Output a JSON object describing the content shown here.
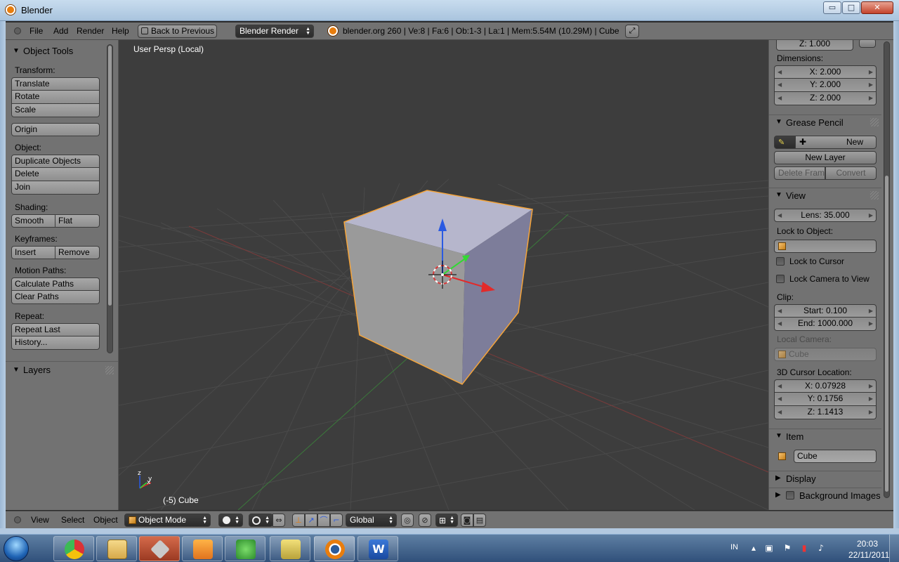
{
  "window": {
    "title": "Blender",
    "min_glyph": "▭",
    "max_glyph": "□",
    "close_glyph": "✕"
  },
  "info_header": {
    "menus": [
      "File",
      "Add",
      "Render",
      "Help"
    ],
    "back_button": "Back to Previous",
    "render_engine": "Blender Render",
    "stats": "blender.org 260 | Ve:8 | Fa:6 | Ob:1-3 | La:1 | Mem:5.54M (10.29M) | Cube"
  },
  "tool_shelf": {
    "title": "Object Tools",
    "transform_label": "Transform:",
    "translate": "Translate",
    "rotate": "Rotate",
    "scale": "Scale",
    "origin": "Origin",
    "object_label": "Object:",
    "duplicate": "Duplicate Objects",
    "delete": "Delete",
    "join": "Join",
    "shading_label": "Shading:",
    "smooth": "Smooth",
    "flat": "Flat",
    "keyframes_label": "Keyframes:",
    "insert": "Insert",
    "remove": "Remove",
    "motion_paths_label": "Motion Paths:",
    "calc_paths": "Calculate Paths",
    "clear_paths": "Clear Paths",
    "repeat_label": "Repeat:",
    "repeat_last": "Repeat Last",
    "history": "History...",
    "layers_title": "Layers"
  },
  "viewport": {
    "label": "User Persp (Local)",
    "object_label": "(-5) Cube",
    "axis_x": "x",
    "axis_y": "y",
    "axis_z": "z"
  },
  "properties": {
    "scale_z": "Z: 1.000",
    "dimensions_label": "Dimensions:",
    "dim_x": "X: 2.000",
    "dim_y": "Y: 2.000",
    "dim_z": "Z: 2.000",
    "grease_pencil_title": "Grease Pencil",
    "new": "New",
    "new_layer": "New Layer",
    "delete_frame": "Delete Frame",
    "convert": "Convert",
    "view_title": "View",
    "lens": "Lens: 35.000",
    "lock_to_object_label": "Lock to Object:",
    "lock_to_cursor": "Lock to Cursor",
    "lock_camera_to_view": "Lock Camera to View",
    "clip_label": "Clip:",
    "clip_start": "Start: 0.100",
    "clip_end": "End: 1000.000",
    "local_camera_label": "Local Camera:",
    "local_camera_value": "Cube",
    "cursor_location_label": "3D Cursor Location:",
    "cursor_x": "X: 0.07928",
    "cursor_y": "Y: 0.1756",
    "cursor_z": "Z: 1.1413",
    "item_title": "Item",
    "item_name": "Cube",
    "display_title": "Display",
    "background_images_title": "Background Images"
  },
  "view_header": {
    "menus": [
      "View",
      "Select",
      "Object"
    ],
    "mode": "Object Mode",
    "orientation": "Global"
  },
  "taskbar": {
    "language": "IN",
    "time": "20:03",
    "date": "22/11/2011"
  },
  "colors": {
    "viewport_bg": "#3d3d3d",
    "panel_bg": "#727272",
    "selection_outline": "#f5a43a",
    "axis_x": "#e22a2a",
    "axis_y": "#33d933",
    "axis_z": "#2a5ae2"
  }
}
